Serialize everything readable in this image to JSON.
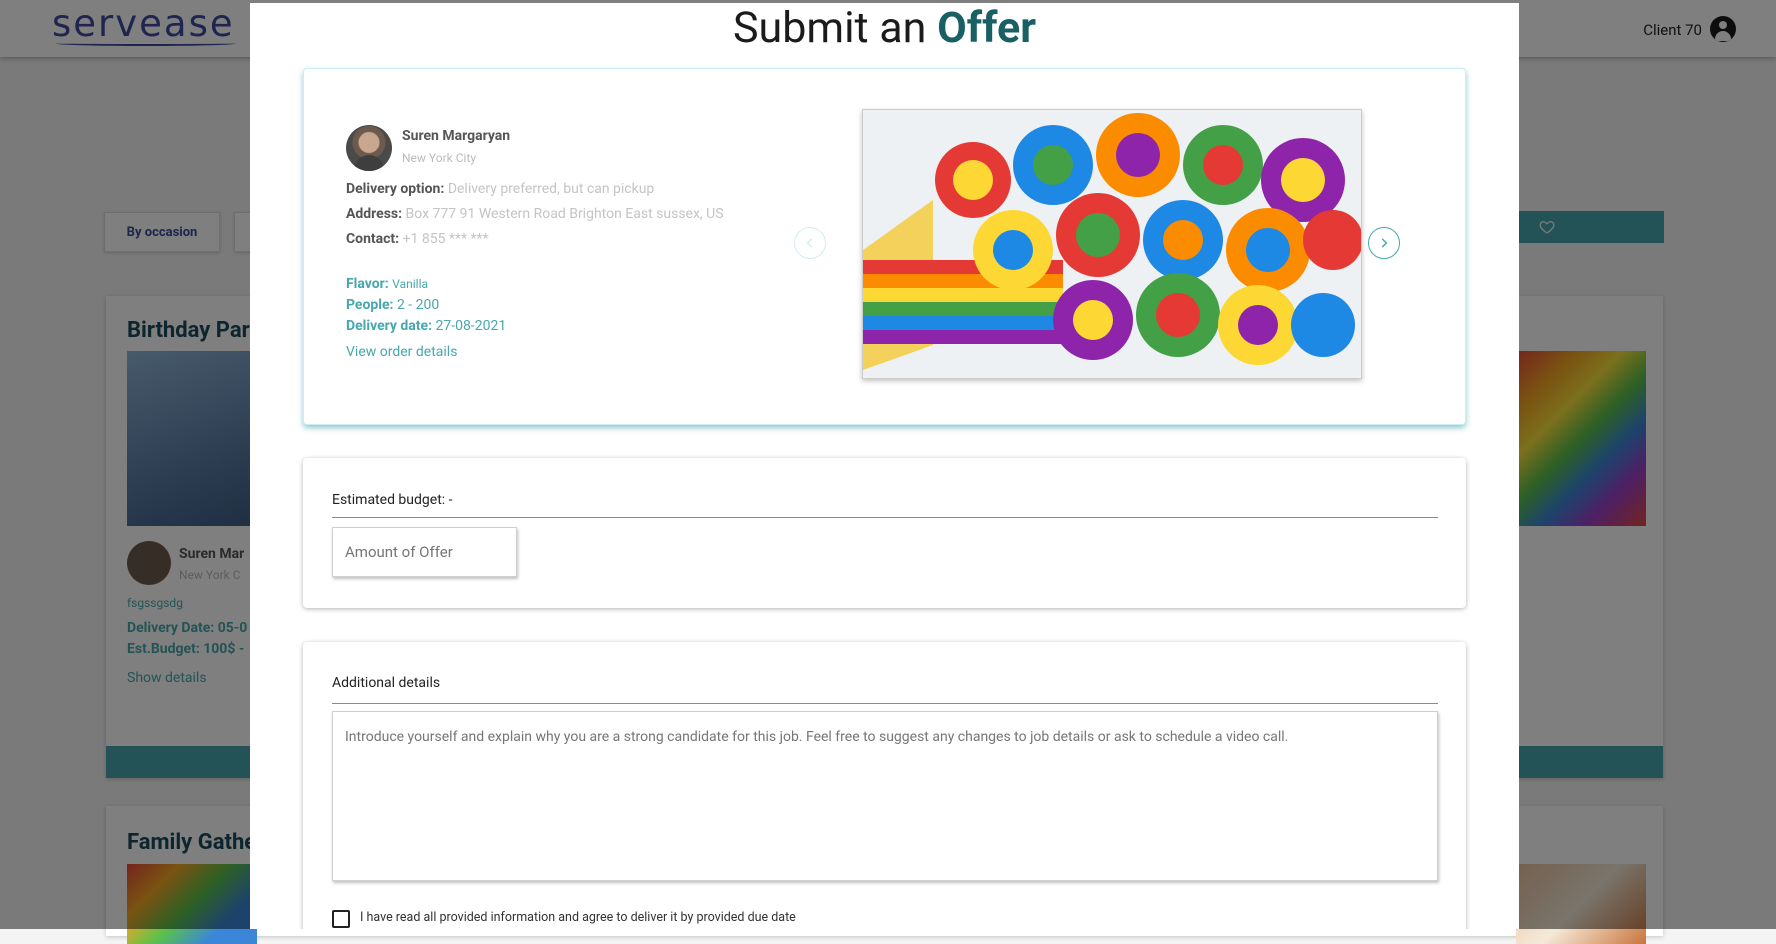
{
  "header": {
    "logo_text": "servease",
    "user_label": "Client 70"
  },
  "background": {
    "filter_label": "By occasion",
    "cards": [
      {
        "title": "Birthday Par",
        "author": "Suren Mar",
        "city": "New York C",
        "note": "fsgssgsdg",
        "delivery": "Delivery Date: 05-0",
        "budget": "Est.Budget: 100$ -",
        "link": "Show details"
      },
      {
        "title": "Family Gathe"
      }
    ]
  },
  "modal": {
    "title_prefix": "Submit an",
    "title_accent": "Offer",
    "order": {
      "name": "Suren Margaryan",
      "city": "New York City",
      "delivery_option_label": "Delivery option:",
      "delivery_option_value": "Delivery preferred, but can pickup",
      "address_label": "Address:",
      "address_value": "Box 777 91 Western Road Brighton East sussex, US",
      "contact_label": "Contact:",
      "contact_value": "+1 855 *** ***",
      "flavor_label": "Flavor:",
      "flavor_value": "Vanilla",
      "people_label": "People:",
      "people_value": "2 - 200",
      "date_label": "Delivery date:",
      "date_value": "27-08-2021",
      "view_link": "View order details"
    },
    "budget": {
      "label": "Estimated budget: -",
      "placeholder": "Amount of Offer"
    },
    "details": {
      "label": "Additional details",
      "placeholder": "Introduce yourself and explain why you are a strong candidate for this job. Feel free to suggest any changes to job details or ask to schedule a video call.",
      "agreement": "I have read all provided information and agree to deliver it by provided due date"
    }
  },
  "icons": [
    "user-circle-icon",
    "chevron-left-icon",
    "chevron-right-icon",
    "heart-icon"
  ],
  "colors": {
    "accent": "#47a7ac",
    "title_accent": "#1a5f63",
    "brand": "#3f4aa0"
  }
}
